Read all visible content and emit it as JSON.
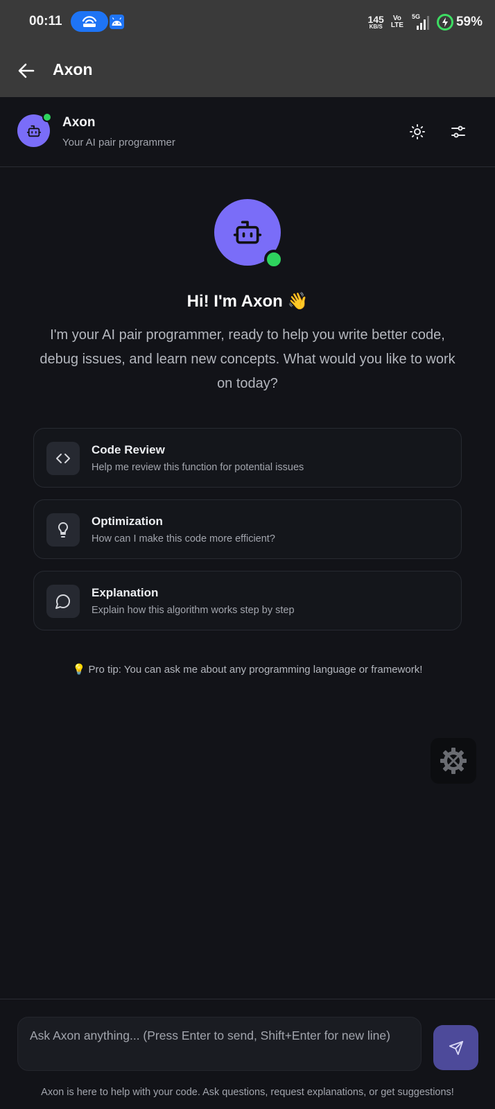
{
  "status_bar": {
    "time": "00:11",
    "net_speed_value": "145",
    "net_speed_unit": "KB/S",
    "volte_top": "Vo",
    "volte_bottom": "LTE",
    "network": "5G",
    "battery": "59%"
  },
  "app_bar": {
    "title": "Axon"
  },
  "chat_header": {
    "name": "Axon",
    "subtitle": "Your AI pair programmer"
  },
  "welcome": {
    "title": "Hi! I'm Axon 👋",
    "text": "I'm your AI pair programmer, ready to help you write better code, debug issues, and learn new concepts. What would you like to work on today?"
  },
  "suggestions": [
    {
      "title": "Code Review",
      "subtitle": "Help me review this function for potential issues",
      "icon": "code-icon"
    },
    {
      "title": "Optimization",
      "subtitle": "How can I make this code more efficient?",
      "icon": "lightbulb-icon"
    },
    {
      "title": "Explanation",
      "subtitle": "Explain how this algorithm works step by step",
      "icon": "chat-bubble-icon"
    }
  ],
  "pro_tip": {
    "icon": "💡",
    "text": "Pro tip: You can ask me about any programming language or framework!"
  },
  "composer": {
    "placeholder": "Ask Axon anything... (Press Enter to send, Shift+Enter for new line)",
    "footer_note": "Axon is here to help with your code. Ask questions, request explanations, or get suggestions!"
  },
  "colors": {
    "accent": "#7a6df8",
    "online": "#2ed45e",
    "background": "#121318"
  }
}
